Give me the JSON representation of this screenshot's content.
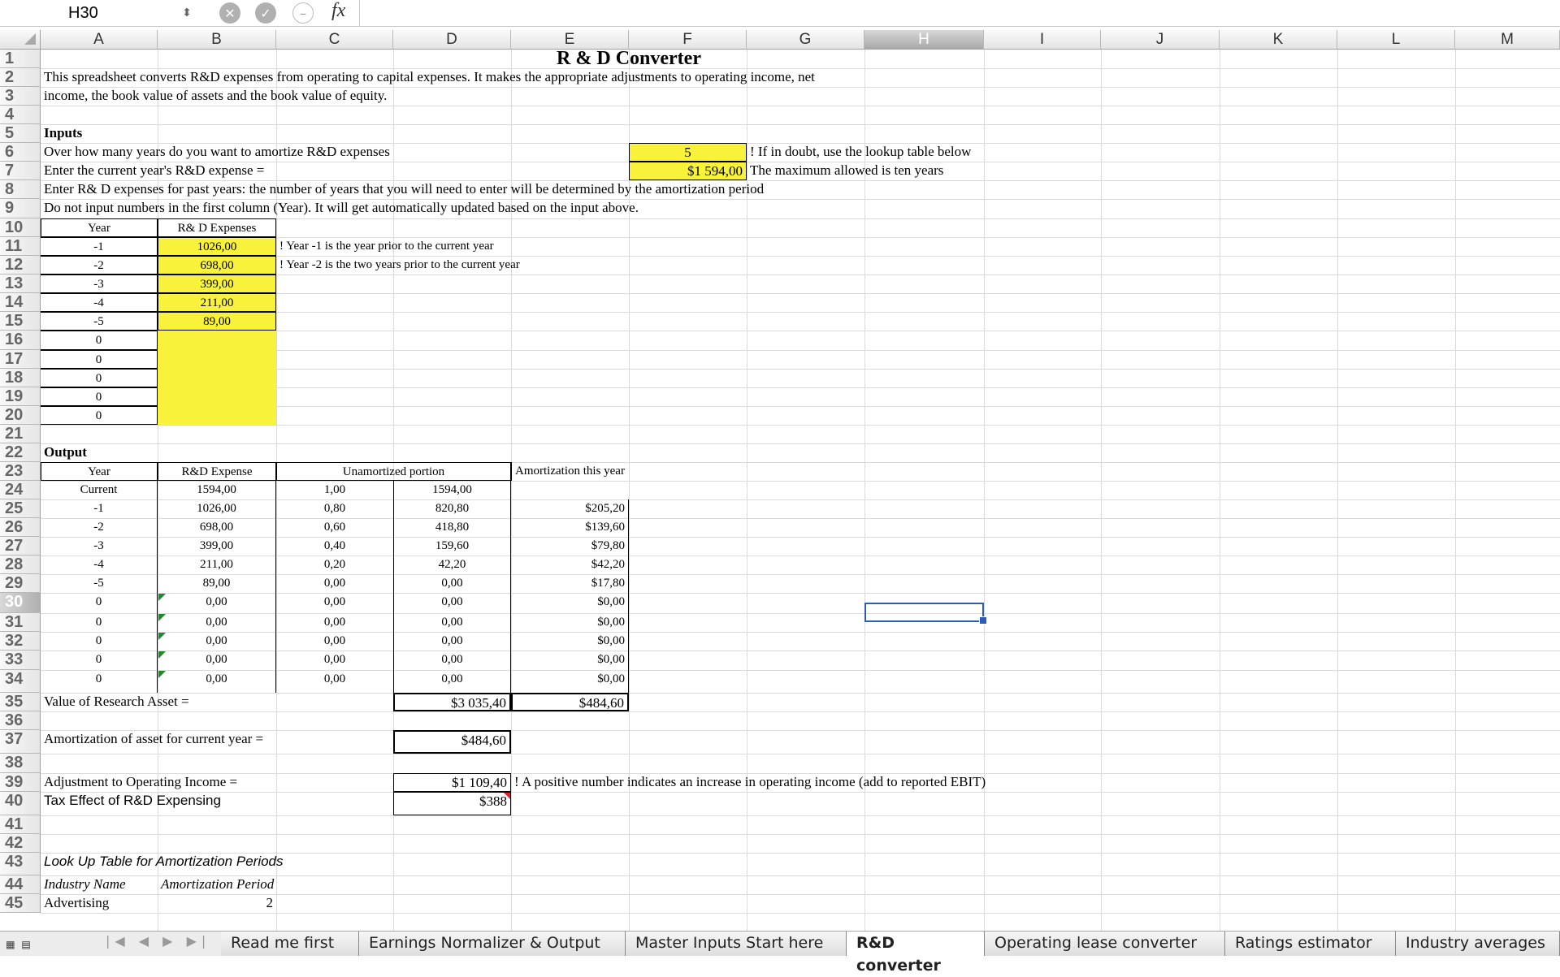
{
  "formula_bar": {
    "name_box": "H30",
    "stepper_icon": "up-down-arrows-icon",
    "cancel_icon": "cancel-icon",
    "confirm_icon": "checkmark-icon",
    "function_icon": "function-icon",
    "fx_label": "fx"
  },
  "columns": [
    "A",
    "B",
    "C",
    "D",
    "E",
    "F",
    "G",
    "H",
    "I",
    "J",
    "K",
    "L",
    "M"
  ],
  "active_column": "H",
  "active_row": "30",
  "rows": [
    "1",
    "2",
    "3",
    "4",
    "5",
    "6",
    "7",
    "8",
    "9",
    "10",
    "11",
    "12",
    "13",
    "14",
    "15",
    "16",
    "17",
    "18",
    "19",
    "20",
    "21",
    "22",
    "23",
    "24",
    "25",
    "26",
    "27",
    "28",
    "29",
    "30",
    "31",
    "32",
    "33",
    "34",
    "35",
    "36",
    "37",
    "38",
    "39",
    "40",
    "41",
    "42",
    "43",
    "44",
    "45"
  ],
  "sheet": {
    "title": "R & D Converter",
    "intro_line1": "This spreadsheet converts R&D expenses from operating to capital expenses. It makes the appropriate adjustments to operating income, net",
    "intro_line2": "income, the book value of assets and the book value of equity.",
    "inputs_label": "Inputs",
    "q_years": "Over how many years do you want to amortize R&D expenses",
    "years_value": "5",
    "years_note": "! If in doubt, use the lookup table below",
    "q_current": "Enter the current year's R&D expense =",
    "current_value": "$1 594,00",
    "current_note": "The maximum allowed is ten years",
    "past_note": "Enter R& D expenses for past years: the number of years that you will need to enter will be determined by the amortization period",
    "first_col_note": "Do not input numbers in the first column (Year). It will get automatically updated  based on the input above.",
    "input_table": {
      "year_header": "Year",
      "expense_header": "R& D Expenses",
      "years": [
        "-1",
        "-2",
        "-3",
        "-4",
        "-5",
        "0",
        "0",
        "0",
        "0",
        "0"
      ],
      "expenses": [
        "1026,00",
        "698,00",
        "399,00",
        "211,00",
        "89,00",
        "",
        "",
        "",
        "",
        ""
      ],
      "note1": "! Year -1 is the year prior to the current year",
      "note2": "! Year -2 is the two years prior to the current year"
    },
    "output_label": "Output",
    "output_table": {
      "h_year": "Year",
      "h_expense": "R&D Expense",
      "h_unamortized": "Unamortized portion",
      "h_amort": "Amortization this year",
      "rows": [
        {
          "year": "Current",
          "expense": "1594,00",
          "frac": "1,00",
          "unamort": "1594,00",
          "amort": ""
        },
        {
          "year": "-1",
          "expense": "1026,00",
          "frac": "0,80",
          "unamort": "820,80",
          "amort": "$205,20"
        },
        {
          "year": "-2",
          "expense": "698,00",
          "frac": "0,60",
          "unamort": "418,80",
          "amort": "$139,60"
        },
        {
          "year": "-3",
          "expense": "399,00",
          "frac": "0,40",
          "unamort": "159,60",
          "amort": "$79,80"
        },
        {
          "year": "-4",
          "expense": "211,00",
          "frac": "0,20",
          "unamort": "42,20",
          "amort": "$42,20"
        },
        {
          "year": "-5",
          "expense": "89,00",
          "frac": "0,00",
          "unamort": "0,00",
          "amort": "$17,80"
        },
        {
          "year": "0",
          "expense": "0,00",
          "frac": "0,00",
          "unamort": "0,00",
          "amort": "$0,00"
        },
        {
          "year": "0",
          "expense": "0,00",
          "frac": "0,00",
          "unamort": "0,00",
          "amort": "$0,00"
        },
        {
          "year": "0",
          "expense": "0,00",
          "frac": "0,00",
          "unamort": "0,00",
          "amort": "$0,00"
        },
        {
          "year": "0",
          "expense": "0,00",
          "frac": "0,00",
          "unamort": "0,00",
          "amort": "$0,00"
        },
        {
          "year": "0",
          "expense": "0,00",
          "frac": "0,00",
          "unamort": "0,00",
          "amort": "$0,00"
        }
      ]
    },
    "research_asset_label": "Value of Research Asset =",
    "research_asset_value": "$3 035,40",
    "research_amort_total": "$484,60",
    "amort_current_label": "Amortization of asset for current year =",
    "amort_current_value": "$484,60",
    "adj_label": "Adjustment to Operating Income =",
    "adj_value": "$1 109,40",
    "adj_note": "! A positive number indicates an increase in operating income (add to reported EBIT)",
    "tax_label": "Tax Effect of R&D Expensing",
    "tax_value": "$388",
    "lookup_title": "Look Up Table for Amortization Periods",
    "lookup_h1": "Industry Name",
    "lookup_h2": "Amortization Period",
    "lookup_r1_name": "Advertising",
    "lookup_r1_value": "2"
  },
  "tabs": [
    {
      "label": "Read me first",
      "active": false
    },
    {
      "label": "Earnings Normalizer & Output",
      "active": false
    },
    {
      "label": "Master Inputs Start here",
      "active": false
    },
    {
      "label": "R&D converter",
      "active": true
    },
    {
      "label": "Operating lease converter",
      "active": false
    },
    {
      "label": "Ratings estimator",
      "active": false
    },
    {
      "label": "Industry averages",
      "active": false
    }
  ],
  "nav_arrows": "|◀ ◀ ▶ ▶|"
}
